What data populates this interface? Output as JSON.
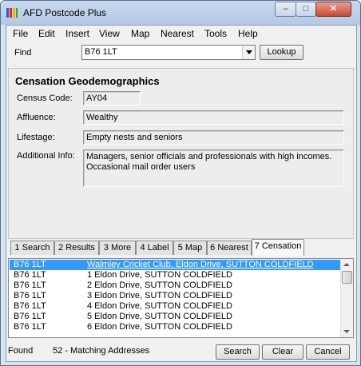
{
  "window": {
    "title": "AFD Postcode Plus"
  },
  "titlebar_buttons": {
    "minimize": "–",
    "maximize": "□",
    "close": "✕"
  },
  "menu": [
    {
      "label": "File"
    },
    {
      "label": "Edit"
    },
    {
      "label": "Insert"
    },
    {
      "label": "View"
    },
    {
      "label": "Map"
    },
    {
      "label": "Nearest"
    },
    {
      "label": "Tools"
    },
    {
      "label": "Help"
    }
  ],
  "find": {
    "label": "Find",
    "value": "B76 1LT",
    "lookup_label": "Lookup"
  },
  "panel": {
    "title": "Censation Geodemographics",
    "census_code": {
      "label": "Census Code:",
      "value": "AY04"
    },
    "affluence": {
      "label": "Affluence:",
      "value": "Wealthy"
    },
    "lifestage": {
      "label": "Lifestage:",
      "value": "Empty nests and seniors"
    },
    "additional": {
      "label": "Additional Info:",
      "line1": "Managers, senior officials and professionals with high incomes.",
      "line2": "Occasional mail order users"
    }
  },
  "tabs": [
    {
      "label": "1 Search"
    },
    {
      "label": "2 Results"
    },
    {
      "label": "3 More"
    },
    {
      "label": "4 Label"
    },
    {
      "label": "5 Map"
    },
    {
      "label": "6 Nearest"
    },
    {
      "label": "7 Censation",
      "active": true
    }
  ],
  "results": [
    {
      "postcode": "B76 1LT",
      "address": "Walmley Cricket Club, Eldon Drive, SUTTON COLDFIELD",
      "selected": true
    },
    {
      "postcode": "B76 1LT",
      "address": "1 Eldon Drive, SUTTON COLDFIELD"
    },
    {
      "postcode": "B76 1LT",
      "address": "2 Eldon Drive, SUTTON COLDFIELD"
    },
    {
      "postcode": "B76 1LT",
      "address": "3 Eldon Drive, SUTTON COLDFIELD"
    },
    {
      "postcode": "B76 1LT",
      "address": "4 Eldon Drive, SUTTON COLDFIELD"
    },
    {
      "postcode": "B76 1LT",
      "address": "5 Eldon Drive, SUTTON COLDFIELD"
    },
    {
      "postcode": "B76 1LT",
      "address": "6 Eldon Drive, SUTTON COLDFIELD"
    }
  ],
  "status": {
    "found_label": "Found",
    "count_text": "52 - Matching Addresses",
    "search_label": "Search",
    "clear_label": "Clear",
    "cancel_label": "Cancel"
  },
  "colors": {
    "selection": "#3399ff",
    "titlebar": "#b4c9e6",
    "close_button": "#c74a34"
  }
}
